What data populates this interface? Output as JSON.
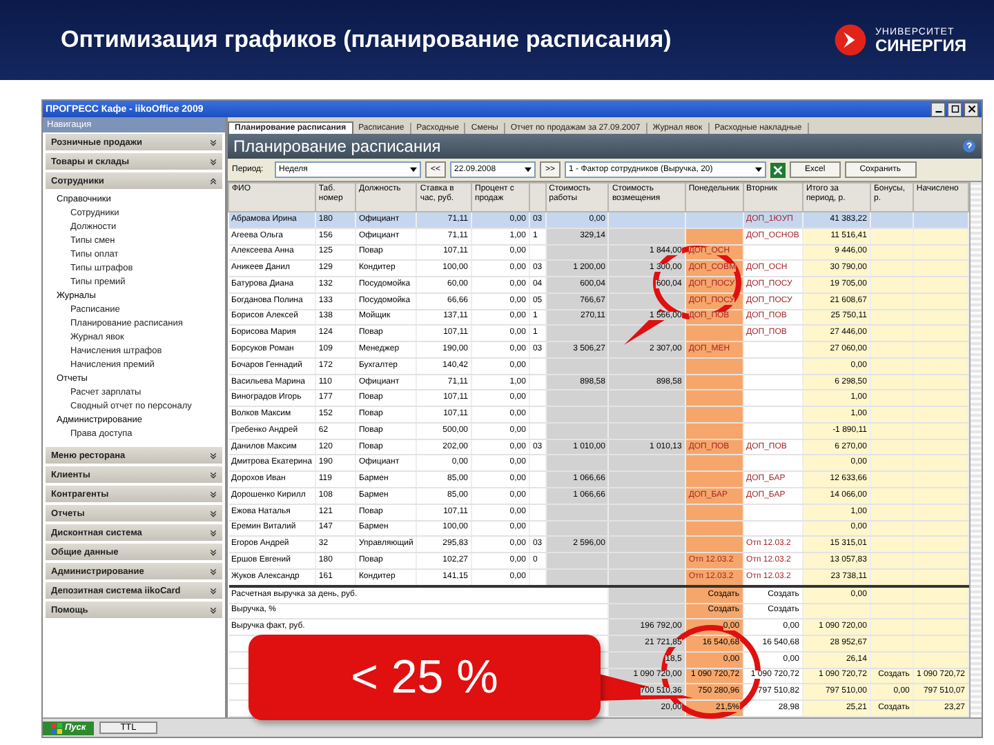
{
  "slide": {
    "title": "Оптимизация графиков (планирование расписания)",
    "logo": {
      "line1": "УНИВЕРСИТЕТ",
      "line2": "СИНЕРГИЯ"
    }
  },
  "window": {
    "title": "ПРОГРЕСС Кафе - iikoOffice 2009"
  },
  "navigation": {
    "title": "Навигация",
    "sections": [
      {
        "label": "Розничные продажи",
        "expanded": false
      },
      {
        "label": "Товары и склады",
        "expanded": false
      },
      {
        "label": "Сотрудники",
        "expanded": true,
        "children": [
          {
            "label": "Справочники",
            "children": [
              {
                "label": "Сотрудники"
              },
              {
                "label": "Должности"
              },
              {
                "label": "Типы смен"
              },
              {
                "label": "Типы оплат"
              },
              {
                "label": "Типы штрафов"
              },
              {
                "label": "Типы премий"
              }
            ]
          },
          {
            "label": "Журналы",
            "children": [
              {
                "label": "Расписание"
              },
              {
                "label": "Планирование расписания"
              },
              {
                "label": "Журнал явок"
              },
              {
                "label": "Начисления штрафов"
              },
              {
                "label": "Начисления премий"
              }
            ]
          },
          {
            "label": "Отчеты",
            "children": [
              {
                "label": "Расчет зарплаты"
              },
              {
                "label": "Сводный отчет по персоналу"
              }
            ]
          },
          {
            "label": "Администрирование",
            "children": [
              {
                "label": "Права доступа"
              }
            ]
          }
        ]
      },
      {
        "label": "Меню ресторана",
        "expanded": false
      },
      {
        "label": "Клиенты",
        "expanded": false
      },
      {
        "label": "Контрагенты",
        "expanded": false
      },
      {
        "label": "Отчеты",
        "expanded": false
      },
      {
        "label": "Дисконтная система",
        "expanded": false
      },
      {
        "label": "Общие данные",
        "expanded": false
      },
      {
        "label": "Администрирование",
        "expanded": false
      },
      {
        "label": "Депозитная система iikoCard",
        "expanded": false
      },
      {
        "label": "Помощь",
        "expanded": false
      }
    ]
  },
  "tabs": [
    {
      "label": "Планирование расписания",
      "selected": true
    },
    {
      "label": "Расписание",
      "selected": false
    },
    {
      "label": "Расходные",
      "selected": false
    },
    {
      "label": "Смены",
      "selected": false
    },
    {
      "label": "Отчет по продажам за 27.09.2007",
      "selected": false
    },
    {
      "label": "Журнал явок",
      "selected": false
    },
    {
      "label": "Расходные накладные",
      "selected": false
    }
  ],
  "page_title": "Планирование расписания",
  "filter": {
    "period_label": "Период:",
    "period": "Неделя",
    "prev": "<<",
    "date": "22.09.2008",
    "next": ">>",
    "plan": "1 - Фактор сотрудников (Выручка, 20)",
    "excel": "Excel",
    "save": "Сохранить"
  },
  "table": {
    "columns": [
      "ФИО",
      "Таб. номер",
      "Должность",
      "Ставка в час, руб.",
      "Процент с продаж",
      "Стоимость работы",
      "Стоимость возмещения",
      "Понедельник",
      "Вторник",
      "Итого за период, р.",
      "Бонусы, р.",
      "Начислено"
    ],
    "rows": [
      {
        "selected": true,
        "name": "Абрамова Ирина",
        "tab": "180",
        "position": "Официант",
        "rate": "71,11",
        "percent": "0,00",
        "code": "03",
        "cost1": "0,00",
        "tue": "ДОП_1ЮУП",
        "total": "41 383,22"
      },
      {
        "selected": false,
        "name": "Агеева Ольга",
        "tab": "156",
        "position": "Официант",
        "rate": "71,11",
        "percent": "1,00",
        "code": "1",
        "cost1": "329,14",
        "tue": "ДОП_ОСНОВ",
        "total": "11 516,41"
      },
      {
        "selected": false,
        "name": "Алексеева Анна",
        "tab": "125",
        "position": "Повар",
        "rate": "107,11",
        "percent": "0,00",
        "cost2": "1 844,00",
        "mon": "ДОП_ОСН",
        "total": "9 446,00"
      },
      {
        "selected": false,
        "name": "Аникеев Данил",
        "tab": "129",
        "position": "Кондитер",
        "rate": "100,00",
        "percent": "0,00",
        "code": "03",
        "cost1": "1 200,00",
        "cost2": "1 300,00",
        "mon": "ДОП_СОВМ",
        "tue": "ДОП_ОСН",
        "total": "30 790,00"
      },
      {
        "selected": false,
        "name": "Батурова Диана",
        "tab": "132",
        "position": "Посудомойка",
        "rate": "60,00",
        "percent": "0,00",
        "code": "04",
        "cost1": "600,04",
        "cost2": "600,04",
        "mon": "ДОП_ПОСУ",
        "tue": "ДОП_ПОСУ",
        "total": "19 705,00"
      },
      {
        "selected": false,
        "name": "Богданова Полина",
        "tab": "133",
        "position": "Посудомойка",
        "rate": "66,66",
        "percent": "0,00",
        "code": "05",
        "cost1": "766,67",
        "mon": "ДОП_ПОСУ",
        "tue": "ДОП_ПОСУ",
        "total": "21 608,67"
      },
      {
        "selected": false,
        "name": "Борисов Алексей",
        "tab": "138",
        "position": "Мойщик",
        "rate": "137,11",
        "percent": "0,00",
        "code": "1",
        "cost1": "270,11",
        "cost2": "1 566,00",
        "mon": "ДОП_ПОВ",
        "tue": "ДОП_ПОВ",
        "total": "25 750,11"
      },
      {
        "selected": false,
        "name": "Борисова Мария",
        "tab": "124",
        "position": "Повар",
        "rate": "107,11",
        "percent": "0,00",
        "code": "1",
        "tue": "ДОП_ПОВ",
        "total": "27 446,00"
      },
      {
        "selected": false,
        "name": "Борсуков Роман",
        "tab": "109",
        "position": "Менеджер",
        "rate": "190,00",
        "percent": "0,00",
        "code": "03",
        "cost1": "3 506,27",
        "cost2": "2 307,00",
        "mon": "ДОП_МЕН",
        "total": "27 060,00"
      },
      {
        "selected": false,
        "name": "Бочаров Геннадий",
        "tab": "172",
        "position": "Бухгалтер",
        "rate": "140,42",
        "percent": "0,00",
        "total": "0,00"
      },
      {
        "selected": false,
        "name": "Васильева Марина",
        "tab": "110",
        "position": "Официант",
        "rate": "71,11",
        "percent": "1,00",
        "cost1": "898,58",
        "cost2": "898,58",
        "total": "6 298,50"
      },
      {
        "selected": false,
        "name": "Виноградов Игорь",
        "tab": "177",
        "position": "Повар",
        "rate": "107,11",
        "percent": "0,00",
        "total": "1,00"
      },
      {
        "selected": false,
        "name": "Волков Максим",
        "tab": "152",
        "position": "Повар",
        "rate": "107,11",
        "percent": "0,00",
        "total": "1,00"
      },
      {
        "selected": false,
        "name": "Гребенко Андрей",
        "tab": "62",
        "position": "Повар",
        "rate": "500,00",
        "percent": "0,00",
        "total": "-1 890,11"
      },
      {
        "selected": false,
        "name": "Данилов Максим",
        "tab": "120",
        "position": "Повар",
        "rate": "202,00",
        "percent": "0,00",
        "code": "03",
        "cost1": "1 010,00",
        "cost2": "1 010,13",
        "mon": "ДОП_ПОВ",
        "tue": "ДОП_ПОВ",
        "total": "6 270,00"
      },
      {
        "selected": false,
        "name": "Дмитрова Екатерина",
        "tab": "190",
        "position": "Официант",
        "rate": "0,00",
        "percent": "0,00",
        "total": "0,00"
      },
      {
        "selected": false,
        "name": "Дорохов Иван",
        "tab": "119",
        "position": "Бармен",
        "rate": "85,00",
        "percent": "0,00",
        "cost1": "1 066,66",
        "tue": "ДОП_БАР",
        "total": "12 633,66"
      },
      {
        "selected": false,
        "name": "Дорошенко Кирилл",
        "tab": "108",
        "position": "Бармен",
        "rate": "85,00",
        "percent": "0,00",
        "cost1": "1 066,66",
        "mon": "ДОП_БАР",
        "tue": "ДОП_БАР",
        "total": "14 066,00"
      },
      {
        "selected": false,
        "name": "Ежова Наталья",
        "tab": "121",
        "position": "Повар",
        "rate": "107,11",
        "percent": "0,00",
        "total": "1,00"
      },
      {
        "selected": false,
        "name": "Еремин Виталий",
        "tab": "147",
        "position": "Бармен",
        "rate": "100,00",
        "percent": "0,00",
        "total": "0,00"
      },
      {
        "selected": false,
        "name": "Егоров Андрей",
        "tab": "32",
        "position": "Управляющий",
        "rate": "295,83",
        "percent": "0,00",
        "code": "03",
        "cost1": "2 596,00",
        "tue": "Отп 12.03.2",
        "total": "15 315,01"
      },
      {
        "selected": false,
        "name": "Ершов Евгений",
        "tab": "180",
        "position": "Повар",
        "rate": "102,27",
        "percent": "0,00",
        "code": "0",
        "mon": "Отп 12.03.2",
        "tue": "Отп 12.03.2",
        "total": "13 057,83"
      },
      {
        "selected": false,
        "name": "Жуков Александр",
        "tab": "161",
        "position": "Кондитер",
        "rate": "141,15",
        "percent": "0,00",
        "mon": "Отп 12.03.2",
        "tue": "Отп 12.03.2",
        "total": "23 738,11"
      }
    ],
    "summary": [
      {
        "label": "Расчетная выручка за день, руб.",
        "mon": "Создать",
        "tue": "Создать",
        "total": "0,00"
      },
      {
        "label": "Выручка, %",
        "mon": "Создать",
        "tue": "Создать"
      },
      {
        "label": "Выручка факт, руб.",
        "cost2": "196 792,00",
        "mon": "0,00",
        "tue": "0,00",
        "total": "1 090 720,00"
      },
      {
        "cost2": "21 721,85",
        "mon": "16 540,68",
        "tue": "16 540,68",
        "total": "28 952,67"
      },
      {
        "cost2": "18,5",
        "mon": "0,00",
        "tue": "0,00",
        "total": "26,14"
      },
      {
        "cost2": "1 090 720,00",
        "mon": "1 090 720,72",
        "tue": "1 090 720,72",
        "total": "1 090 720,72",
        "bonus": "Создать",
        "nach": "1 090 720,72"
      },
      {
        "cost2": "700 510,36",
        "mon": "750 280,96",
        "tue": "797 510,82",
        "total": "797 510,00",
        "bonus": "0,00",
        "nach": "797 510,07"
      },
      {
        "cost2": "20,00",
        "mon": "21,5%",
        "tue": "28,98",
        "total": "25,21",
        "bonus": "Создать",
        "nach": "23,27"
      }
    ]
  },
  "taskbar": {
    "start": "Пуск",
    "items": [
      "TTL"
    ]
  },
  "callout": {
    "text": "< 25 %"
  }
}
